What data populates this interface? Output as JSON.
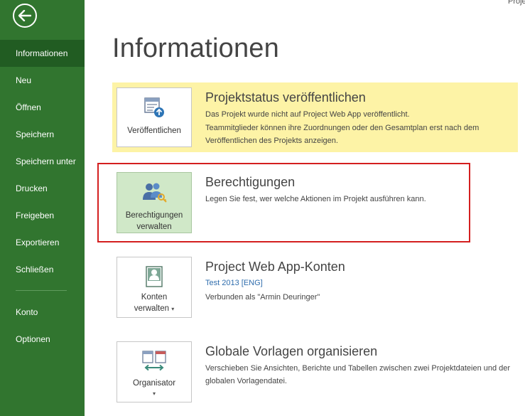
{
  "app": {
    "corner_title": "Projekt"
  },
  "sidebar": {
    "items": [
      {
        "label": "Informationen"
      },
      {
        "label": "Neu"
      },
      {
        "label": "Öffnen"
      },
      {
        "label": "Speichern"
      },
      {
        "label": "Speichern unter"
      },
      {
        "label": "Drucken"
      },
      {
        "label": "Freigeben"
      },
      {
        "label": "Exportieren"
      },
      {
        "label": "Schließen"
      },
      {
        "label": "Konto"
      },
      {
        "label": "Optionen"
      }
    ]
  },
  "main": {
    "title": "Informationen",
    "sections": [
      {
        "title": "Projektstatus veröffentlichen",
        "tile_label": "Veröffentlichen",
        "desc1": "Das Projekt wurde nicht auf Project Web App veröffentlicht.",
        "desc2": "Teammitglieder können ihre Zuordnungen oder den Gesamtplan erst nach dem Veröffentlichen des Projekts anzeigen."
      },
      {
        "title": "Berechtigungen",
        "tile_label_line1": "Berechtigungen",
        "tile_label_line2": "verwalten",
        "desc1": "Legen Sie fest, wer welche Aktionen im Projekt ausführen kann."
      },
      {
        "title": "Project Web App-Konten",
        "tile_label_line1": "Konten",
        "tile_label_line2": "verwalten",
        "link": "Test 2013 [ENG]",
        "desc1": "Verbunden als \"Armin Deuringer\""
      },
      {
        "title": "Globale Vorlagen organisieren",
        "tile_label": "Organisator",
        "desc1": "Verschieben Sie Ansichten, Berichte und Tabellen zwischen zwei Projektdateien und der globalen Vorlagendatei."
      }
    ]
  },
  "colors": {
    "sidebar": "#31752f",
    "sidebar_active": "#215c22",
    "highlight": "#fdf3a6",
    "selected_tile": "#d0e8c8",
    "annotation": "#d41f1f"
  }
}
